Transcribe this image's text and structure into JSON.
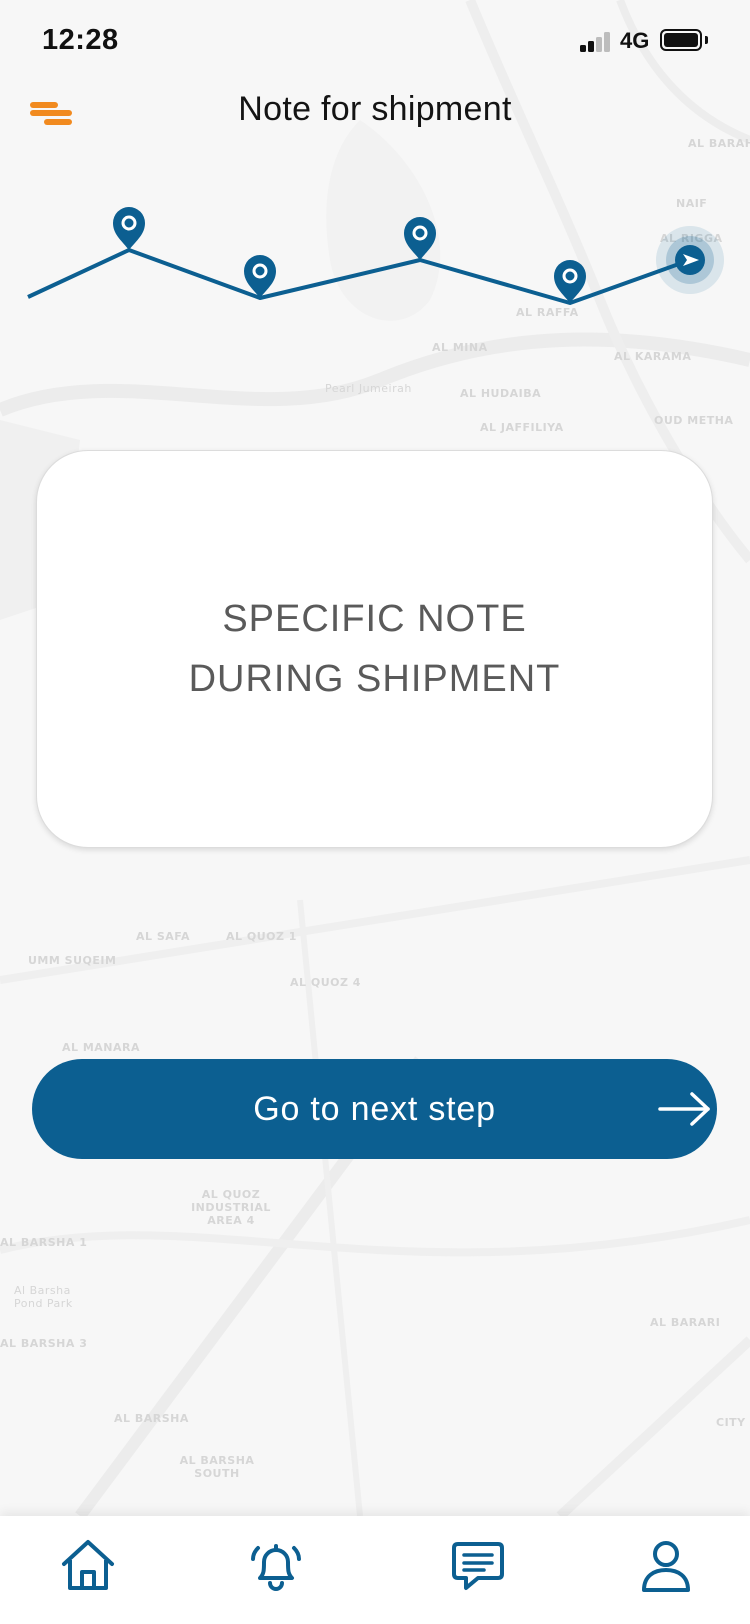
{
  "status_bar": {
    "time": "12:28",
    "network": "4G"
  },
  "header": {
    "title": "Note for shipment",
    "menu_icon": "menu-icon"
  },
  "map": {
    "labels": [
      "AL BARAH",
      "NAIF",
      "AL RIGGA",
      "AL RAFFA",
      "AL MINA",
      "AL KARAMA",
      "Pearl Jumeirah",
      "AL HUDAIBA",
      "AL JAFFILIYA",
      "OUD METHA",
      "UMM SUQEIM",
      "AL SAFA",
      "AL QUOZ 1",
      "AL QUOZ 4",
      "AL MANARA",
      "AL QUOZ INDUSTRIAL AREA 4",
      "AL BARSHA 1",
      "Al Barsha Pond Park",
      "AL BARSHA 3",
      "AL BARARI",
      "AL BARSHA",
      "AL BARSHA SOUTH",
      "CITY"
    ]
  },
  "progress": {
    "steps_total": 5,
    "current_step": 5,
    "step_icon": "location-pin-icon",
    "current_icon": "navigation-arrow-icon"
  },
  "card": {
    "text": "SPECIFIC NOTE DURING SHIPMENT"
  },
  "actions": {
    "next_label": "Go to next step",
    "next_icon": "arrow-right-icon"
  },
  "tab_bar": {
    "items": [
      {
        "icon": "home-icon"
      },
      {
        "icon": "bell-icon"
      },
      {
        "icon": "chat-icon"
      },
      {
        "icon": "profile-icon"
      }
    ]
  },
  "colors": {
    "accent": "#f18a1f",
    "primary": "#0c5f91",
    "background": "#f7f7f7",
    "card": "#ffffff"
  }
}
